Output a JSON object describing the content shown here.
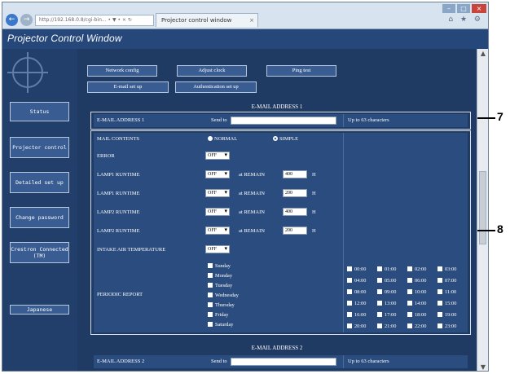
{
  "browser": {
    "address": "http://192.168.0.8/cgi-bin... • ▼ • × ↻",
    "tab_label": "Projector control window",
    "tab_close": "×",
    "back_icon": "←",
    "forward_icon": "→",
    "tools": "⌂ ★ ⚙",
    "window_min": "–",
    "window_max": "□",
    "window_close": "×"
  },
  "app": {
    "title": "Projector Control Window"
  },
  "sidebar": {
    "items": [
      {
        "label": "Status"
      },
      {
        "label": "Projector control"
      },
      {
        "label": "Detailed set up"
      },
      {
        "label": "Change password"
      },
      {
        "label": "Crestron Connected (TM)"
      },
      {
        "label": "Japanese"
      }
    ]
  },
  "tabs": {
    "row1": [
      "Network config",
      "Adjust clock",
      "Ping test"
    ],
    "row2": [
      "E-mail set up",
      "Authentication set up"
    ]
  },
  "email1": {
    "header": "E-MAIL ADDRESS 1",
    "label": "E-MAIL ADDRESS 1",
    "send_to": "Send to",
    "value": "",
    "note": "Up to 63 characters"
  },
  "settings": {
    "mail_contents": {
      "label": "MAIL CONTENTS",
      "options": [
        "NORMAL",
        "SIMPLE"
      ],
      "selected": "SIMPLE"
    },
    "error": {
      "label": "ERROR",
      "value": "OFF"
    },
    "runtime_rows": [
      {
        "label": "LAMP1 RUNTIME",
        "value": "OFF",
        "remain_label": "at REMAIN",
        "remain": "400",
        "unit": "H"
      },
      {
        "label": "LAMP1 RUNTIME",
        "value": "OFF",
        "remain_label": "at REMAIN",
        "remain": "200",
        "unit": "H"
      },
      {
        "label": "LAMP2 RUNTIME",
        "value": "OFF",
        "remain_label": "at REMAIN",
        "remain": "400",
        "unit": "H"
      },
      {
        "label": "LAMP2 RUNTIME",
        "value": "OFF",
        "remain_label": "at REMAIN",
        "remain": "200",
        "unit": "H"
      }
    ],
    "intake": {
      "label": "INTAKE AIR TEMPERATURE",
      "value": "OFF"
    },
    "periodic": {
      "label": "PERIODIC REPORT",
      "days": [
        "Sunday",
        "Monday",
        "Tuesday",
        "Wednesday",
        "Thursday",
        "Friday",
        "Saturday"
      ],
      "times": [
        [
          "00:00",
          "01:00",
          "02:00",
          "03:00"
        ],
        [
          "04:00",
          "05:00",
          "06:00",
          "07:00"
        ],
        [
          "08:00",
          "09:00",
          "10:00",
          "11:00"
        ],
        [
          "12:00",
          "13:00",
          "14:00",
          "15:00"
        ],
        [
          "16:00",
          "17:00",
          "18:00",
          "19:00"
        ],
        [
          "20:00",
          "21:00",
          "22:00",
          "23:00"
        ]
      ]
    }
  },
  "email2": {
    "header": "E-MAIL ADDRESS 2",
    "label": "E-MAIL ADDRESS 2",
    "send_to": "Send to",
    "value": "",
    "note": "Up to 63 characters"
  },
  "callouts": [
    "7",
    "8"
  ],
  "scrollbar": {
    "up": "▲",
    "down": "▼"
  }
}
